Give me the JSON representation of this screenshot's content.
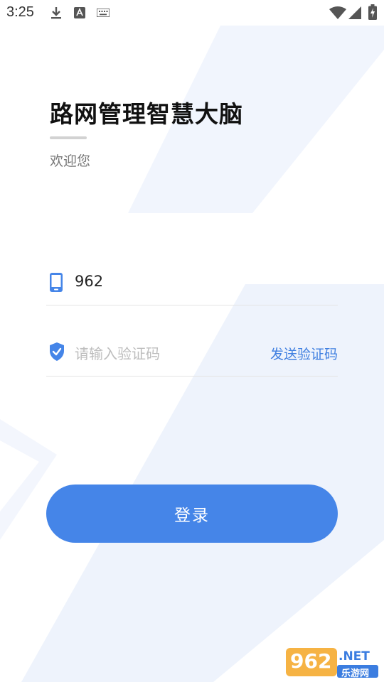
{
  "status_bar": {
    "time": "3:25",
    "icons": [
      "download-icon",
      "keyboard-a-icon",
      "keyboard-icon",
      "wifi-icon",
      "signal-icon",
      "battery-icon"
    ]
  },
  "header": {
    "title": "路网管理智慧大脑",
    "subtitle": "欢迎您"
  },
  "form": {
    "phone": {
      "icon": "phone-icon",
      "value": "962"
    },
    "code": {
      "icon": "shield-check-icon",
      "placeholder": "请输入验证码",
      "value": "",
      "send_label": "发送验证码"
    },
    "login_label": "登录"
  },
  "watermark": {
    "brand": "962",
    "suffix": ".NET",
    "sub": "乐游网"
  },
  "colors": {
    "accent": "#4585e8",
    "link": "#3f7fe0",
    "bg_shape": "#eef3fc"
  }
}
